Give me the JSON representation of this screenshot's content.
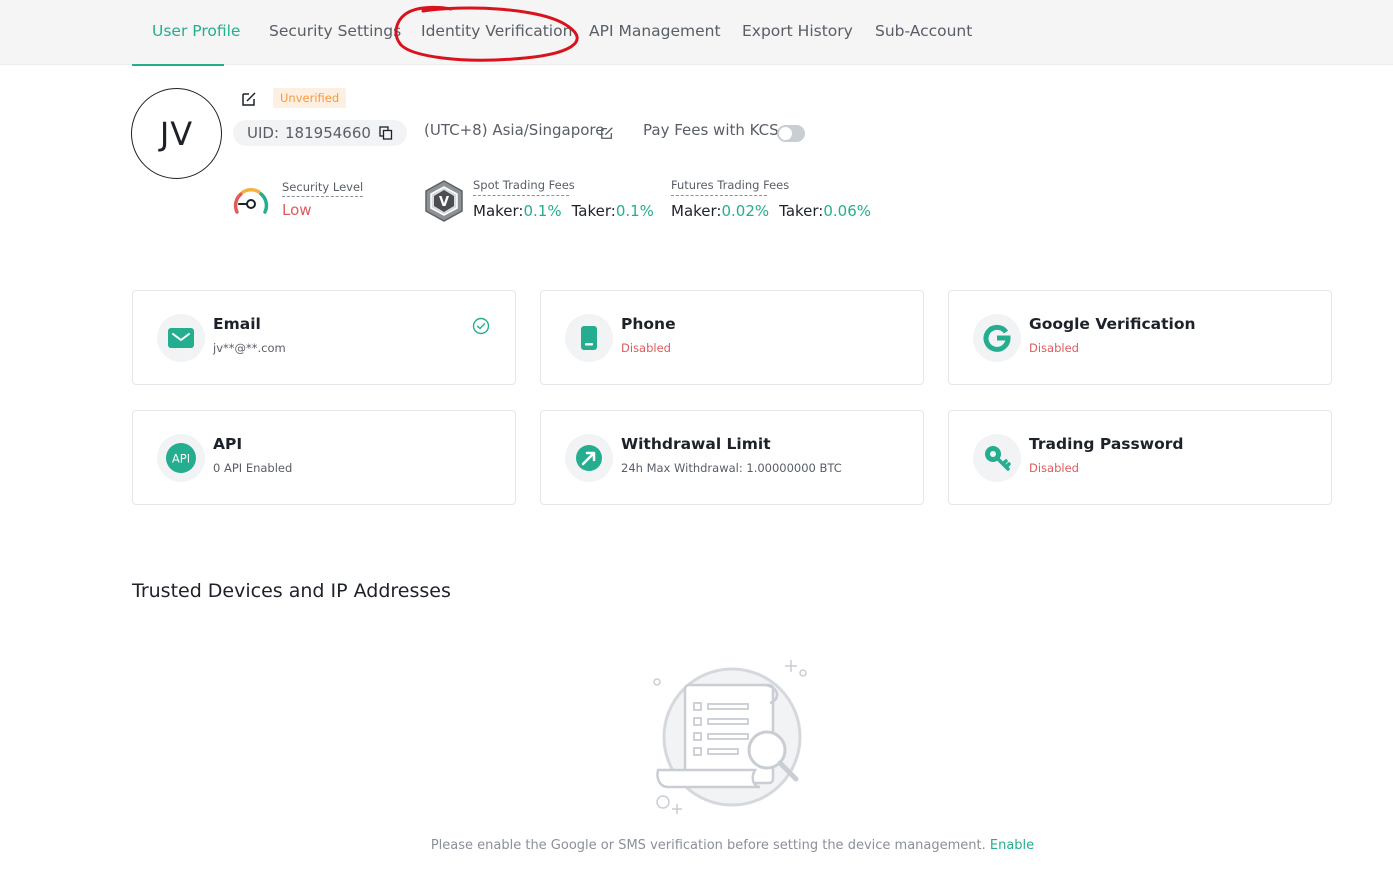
{
  "nav": {
    "tabs": [
      {
        "label": "User Profile",
        "active": true
      },
      {
        "label": "Security Settings",
        "active": false
      },
      {
        "label": "Identity Verification",
        "active": false,
        "circled": true
      },
      {
        "label": "API Management",
        "active": false
      },
      {
        "label": "Export History",
        "active": false
      },
      {
        "label": "Sub-Account",
        "active": false
      }
    ]
  },
  "profile": {
    "initials": "JV",
    "verification_badge": "Unverified",
    "uid_label": "UID:",
    "uid": "181954660",
    "timezone": "(UTC+8) Asia/Singapore",
    "pay_fees_label": "Pay Fees with KCS",
    "pay_fees_enabled": false,
    "security_level_label": "Security Level",
    "security_level": "Low",
    "spot_fees_label": "Spot Trading Fees",
    "futures_fees_label": "Futures Trading Fees",
    "maker_label": "Maker:",
    "taker_label": "Taker:",
    "spot_maker": "0.1%",
    "spot_taker": "0.1%",
    "futures_maker": "0.02%",
    "futures_taker": "0.06%",
    "vip_letter": "V"
  },
  "cards": [
    {
      "title": "Email",
      "sub": "jv**@**.com",
      "status": "enabled",
      "icon": "email-icon"
    },
    {
      "title": "Phone",
      "sub": "Disabled",
      "status": "disabled",
      "icon": "phone-icon"
    },
    {
      "title": "Google Verification",
      "sub": "Disabled",
      "status": "disabled",
      "icon": "google-icon"
    },
    {
      "title": "API",
      "sub": "0 API Enabled",
      "status": "info",
      "icon": "api-icon",
      "icon_text": "API"
    },
    {
      "title": "Withdrawal Limit",
      "sub": "24h Max Withdrawal: 1.00000000 BTC",
      "status": "info",
      "icon": "withdrawal-icon"
    },
    {
      "title": "Trading Password",
      "sub": "Disabled",
      "status": "disabled",
      "icon": "key-icon"
    }
  ],
  "trusted_devices": {
    "title": "Trusted Devices and IP Addresses",
    "message": "Please enable the Google or SMS verification before setting the device management.",
    "link": "Enable"
  },
  "colors": {
    "accent": "#24ae8f",
    "danger": "#e05c5c",
    "warning": "#f59a3c",
    "annotation": "#d9131d"
  }
}
